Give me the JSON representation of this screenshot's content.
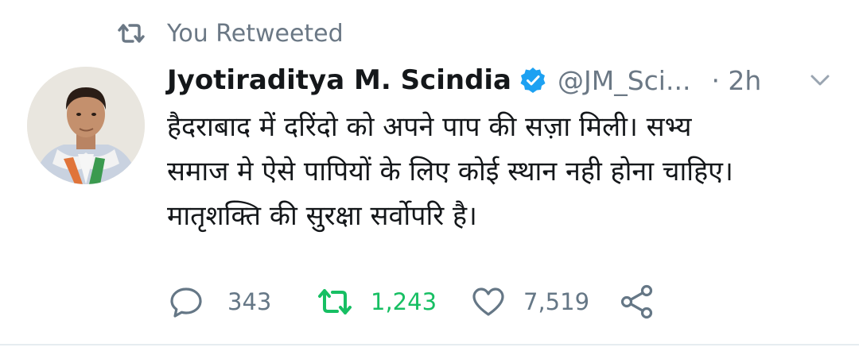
{
  "retweet_context": {
    "icon": "retweet-icon",
    "label": "You Retweeted"
  },
  "author": {
    "display_name": "Jyotiraditya M. Scindia",
    "verified_icon": "verified-badge-icon",
    "handle": "@JM_Sci...",
    "time_ago": "· 2h",
    "menu_icon": "chevron-down-icon"
  },
  "tweet": {
    "lines": [
      "हैदराबाद में दरिंदो को अपने पाप की  सज़ा मिली।  सभ्य",
      "समाज मे ऐसे पापियों के लिए कोई स्थान नही होना चाहिए।",
      "मातृशक्ति की सुरक्षा सर्वोपरि है।"
    ]
  },
  "actions": {
    "reply": {
      "icon": "reply-icon",
      "count": "343"
    },
    "retweet": {
      "icon": "retweet-icon",
      "count": "1,243",
      "active": true
    },
    "like": {
      "icon": "heart-icon",
      "count": "7,519"
    },
    "share": {
      "icon": "share-icon"
    }
  },
  "colors": {
    "text_primary": "#14171a",
    "text_secondary": "#657786",
    "verified_blue": "#1da1f2",
    "retweet_green": "#17bf63"
  }
}
